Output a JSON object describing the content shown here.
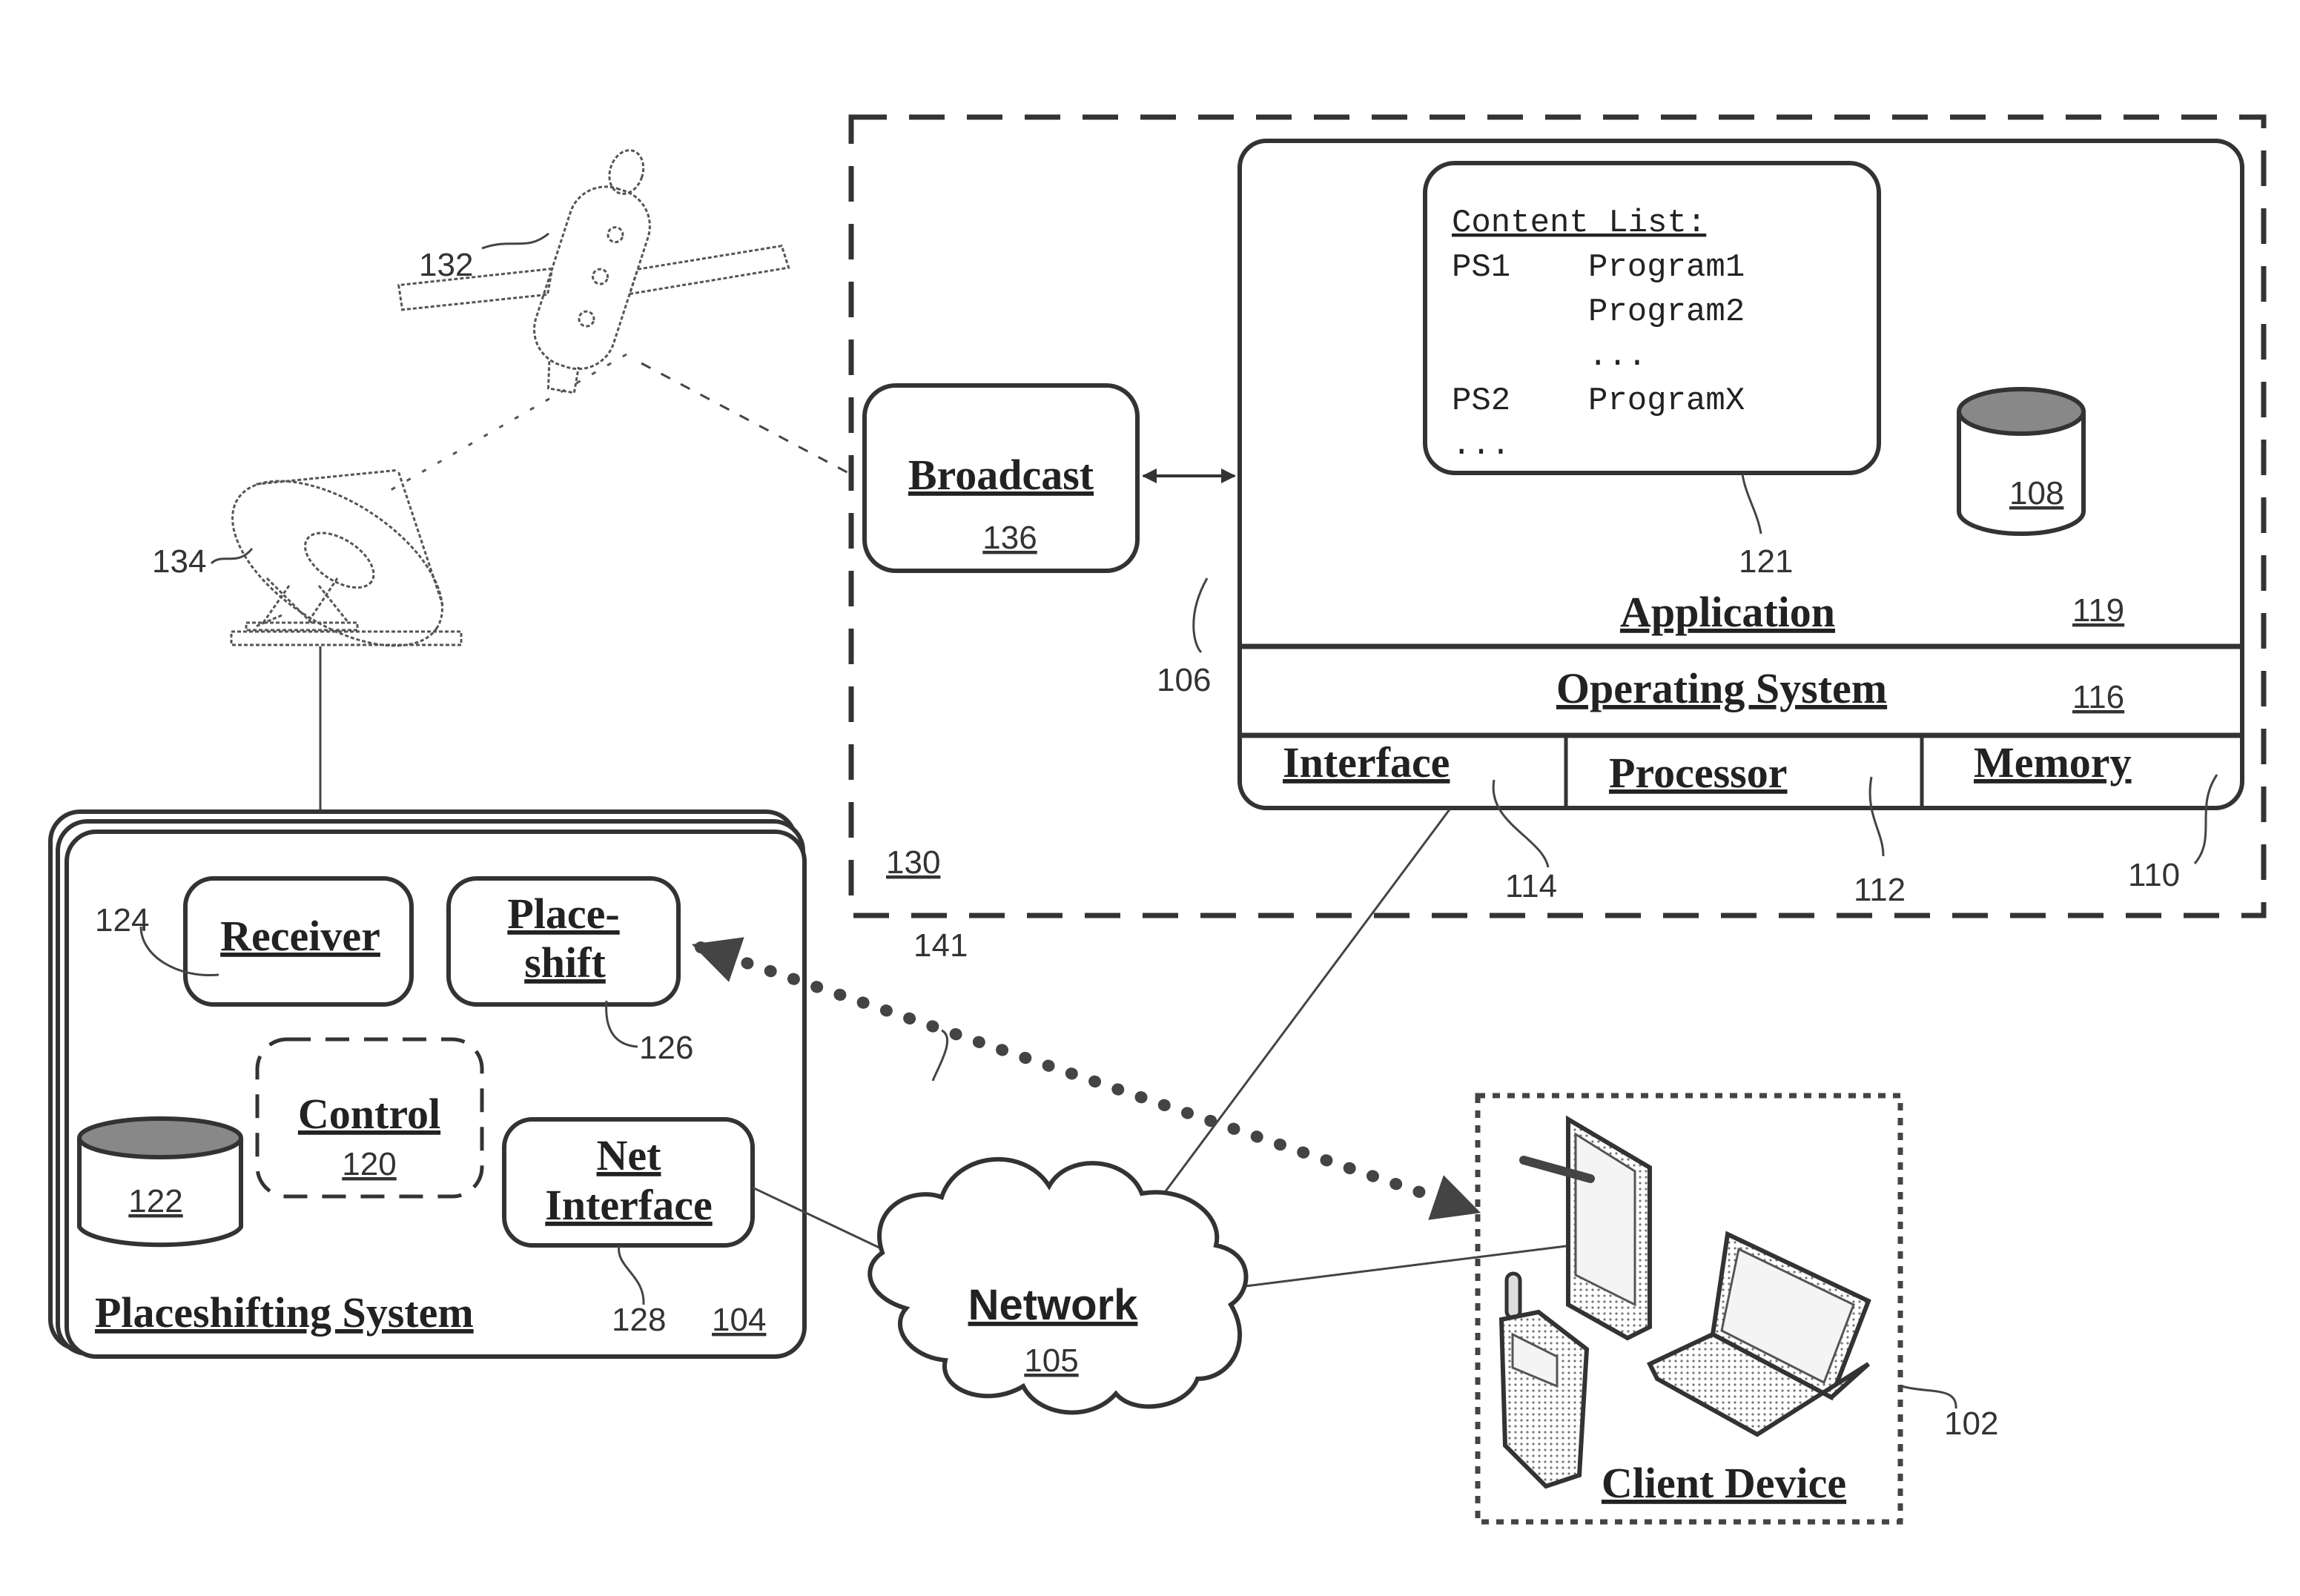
{
  "figure": {
    "system_boundary": {
      "ref": "130"
    },
    "satellite": {
      "ref": "132"
    },
    "dish": {
      "ref": "134"
    },
    "broadcast": {
      "label": "Broadcast",
      "ref": "136"
    },
    "device": {
      "ref": "106",
      "content_list": {
        "title": "Content List:",
        "rows": [
          {
            "source": "PS1",
            "program": "Program1"
          },
          {
            "source": "",
            "program": "Program2"
          },
          {
            "source": "",
            "program": "..."
          },
          {
            "source": "PS2",
            "program": "ProgramX"
          },
          {
            "source": "...",
            "program": ""
          }
        ],
        "ref": "121"
      },
      "storage": {
        "ref": "108"
      },
      "application": {
        "label": "Application",
        "ref": "119"
      },
      "operating_system": {
        "label": "Operating System",
        "ref": "116"
      },
      "interface": {
        "label": "Interface",
        "ref": "114"
      },
      "processor": {
        "label": "Processor",
        "ref": "112"
      },
      "memory": {
        "label": "Memory",
        "ref": "110"
      }
    },
    "placeshifting_system": {
      "label": "Placeshifting System",
      "ref": "104",
      "receiver": {
        "label": "Receiver",
        "ref": "124"
      },
      "placeshift": {
        "label_line1": "Place-",
        "label_line2": "shift",
        "ref": "126"
      },
      "control": {
        "label": "Control",
        "ref": "120"
      },
      "net_interface": {
        "label_line1": "Net",
        "label_line2": "Interface",
        "ref": "128"
      },
      "storage": {
        "ref": "122"
      }
    },
    "stream_link": {
      "ref": "141"
    },
    "network": {
      "label": "Network",
      "ref": "105"
    },
    "client_device": {
      "label": "Client Device",
      "ref": "102"
    }
  }
}
